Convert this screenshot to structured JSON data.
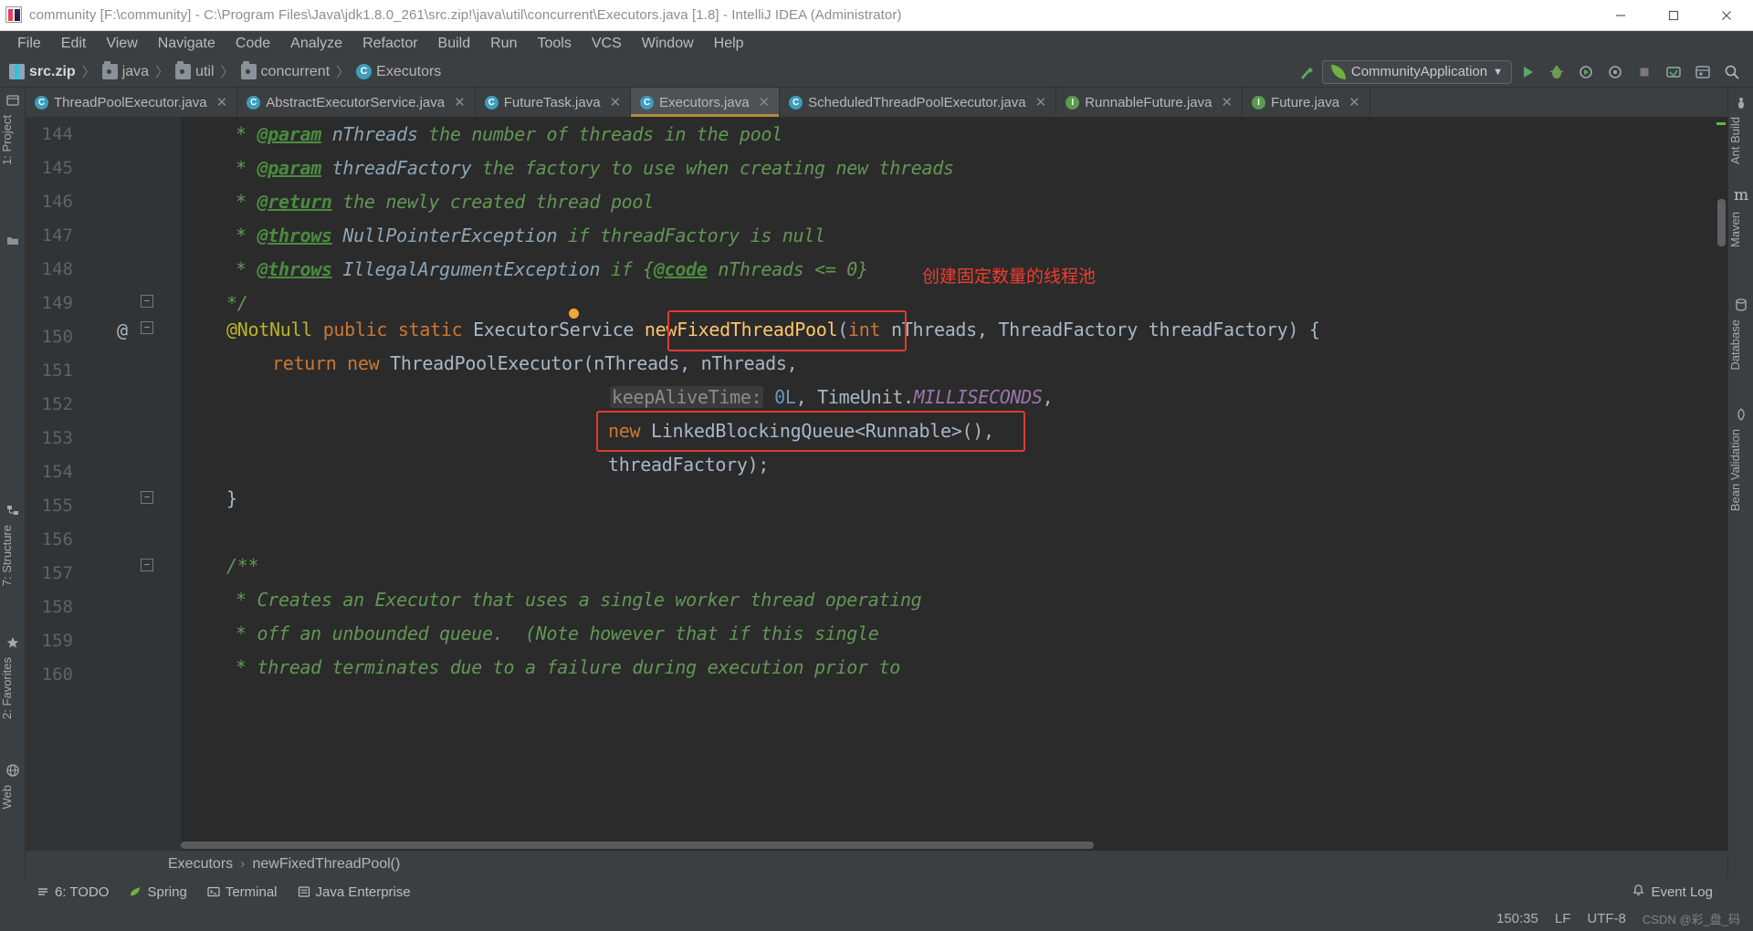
{
  "window": {
    "title": "community [F:\\community] - C:\\Program Files\\Java\\jdk1.8.0_261\\src.zip!\\java\\util\\concurrent\\Executors.java [1.8] - IntelliJ IDEA (Administrator)",
    "app_icon": "intellij-idea-icon",
    "minimize_label": "Minimize",
    "maximize_label": "Maximize",
    "close_label": "Close"
  },
  "menubar": {
    "items": [
      {
        "label": "File",
        "mnemonic": "F"
      },
      {
        "label": "Edit",
        "mnemonic": "E"
      },
      {
        "label": "View",
        "mnemonic": "V"
      },
      {
        "label": "Navigate",
        "mnemonic": "N"
      },
      {
        "label": "Code",
        "mnemonic": "C"
      },
      {
        "label": "Analyze",
        "mnemonic": "z"
      },
      {
        "label": "Refactor",
        "mnemonic": "R"
      },
      {
        "label": "Build",
        "mnemonic": "B"
      },
      {
        "label": "Run",
        "mnemonic": "u"
      },
      {
        "label": "Tools",
        "mnemonic": "T"
      },
      {
        "label": "VCS",
        "mnemonic": "S"
      },
      {
        "label": "Window",
        "mnemonic": "W"
      },
      {
        "label": "Help",
        "mnemonic": "H"
      }
    ]
  },
  "navbar": {
    "breadcrumbs": [
      {
        "label": "src.zip",
        "icon": "zip-icon",
        "active": true
      },
      {
        "label": "java",
        "icon": "folder-icon",
        "active": false
      },
      {
        "label": "util",
        "icon": "folder-icon",
        "active": false
      },
      {
        "label": "concurrent",
        "icon": "folder-icon",
        "active": false
      },
      {
        "label": "Executors",
        "icon": "class-icon",
        "active": false
      }
    ],
    "separator": "〉",
    "run_configuration": "CommunityApplication",
    "run_config_icon": "spring-boot-icon",
    "dropdown_icon": "chevron-down-icon",
    "toolbar_buttons": [
      {
        "name": "run-button",
        "icon": "play-icon",
        "color": "#59a869"
      },
      {
        "name": "debug-button",
        "icon": "bug-icon",
        "color": "#9aa7b0"
      },
      {
        "name": "run-with-coverage-button",
        "icon": "coverage-icon",
        "color": "#9aa7b0"
      },
      {
        "name": "profiler-button",
        "icon": "profiler-icon",
        "color": "#9aa7b0"
      },
      {
        "name": "stop-button",
        "icon": "stop-icon",
        "color": "#7a7a7a"
      },
      {
        "name": "update-project-button",
        "icon": "update-icon",
        "color": "#9aa7b0"
      },
      {
        "name": "settings-button",
        "icon": "gear-icon",
        "color": "#9aa7b0"
      },
      {
        "name": "search-everywhere-button",
        "icon": "search-icon",
        "color": "#9aa7b0"
      }
    ],
    "make_project_icon": "hammer-icon"
  },
  "editor_tabs": [
    {
      "label": "ThreadPoolExecutor.java",
      "icon": "class-icon",
      "selected": false,
      "close_icon": "close-icon"
    },
    {
      "label": "AbstractExecutorService.java",
      "icon": "class-icon",
      "selected": false,
      "close_icon": "close-icon"
    },
    {
      "label": "FutureTask.java",
      "icon": "class-icon",
      "selected": false,
      "close_icon": "close-icon"
    },
    {
      "label": "Executors.java",
      "icon": "class-icon",
      "selected": true,
      "close_icon": "close-icon"
    },
    {
      "label": "ScheduledThreadPoolExecutor.java",
      "icon": "class-icon",
      "selected": false,
      "close_icon": "close-icon"
    },
    {
      "label": "RunnableFuture.java",
      "icon": "interface-icon",
      "selected": false,
      "close_icon": "close-icon"
    },
    {
      "label": "Future.java",
      "icon": "interface-icon",
      "selected": false,
      "close_icon": "close-icon"
    }
  ],
  "left_tool_window_bars": [
    {
      "label": "1: Project",
      "icon": "project-icon"
    },
    {
      "label": "7: Structure",
      "icon": "structure-icon"
    },
    {
      "label": "2: Favorites",
      "icon": "favorites-icon"
    },
    {
      "label": "Web",
      "icon": "web-icon"
    }
  ],
  "right_tool_window_bars": [
    {
      "label": "Ant Build",
      "icon": "ant-icon"
    },
    {
      "label": "Maven",
      "icon": "maven-icon"
    },
    {
      "label": "Database",
      "icon": "database-icon"
    },
    {
      "label": "Bean Validation",
      "icon": "bean-icon"
    }
  ],
  "code": {
    "lines": [
      {
        "num": "144",
        "text": " * @param nThreads the number of threads in the pool"
      },
      {
        "num": "145",
        "text": " * @param threadFactory the factory to use when creating new threads"
      },
      {
        "num": "146",
        "text": " * @return the newly created thread pool"
      },
      {
        "num": "147",
        "text": " * @throws NullPointerException if threadFactory is null"
      },
      {
        "num": "148",
        "text": " * @throws IllegalArgumentException if {@code nThreads <= 0}"
      },
      {
        "num": "149",
        "text": " */"
      },
      {
        "num": "150",
        "text": "@NotNull public static ExecutorService newFixedThreadPool(int nThreads, ThreadFactory threadFactory) {"
      },
      {
        "num": "151",
        "text": "    return new ThreadPoolExecutor(nThreads, nThreads,"
      },
      {
        "num": "152",
        "text": "                 keepAliveTime: 0L, TimeUnit.MILLISECONDS,"
      },
      {
        "num": "153",
        "text": "                 new LinkedBlockingQueue<Runnable>(),"
      },
      {
        "num": "154",
        "text": "                 threadFactory);"
      },
      {
        "num": "155",
        "text": "}"
      },
      {
        "num": "156",
        "text": ""
      },
      {
        "num": "157",
        "text": "/**"
      },
      {
        "num": "158",
        "text": " * Creates an Executor that uses a single worker thread operating"
      },
      {
        "num": "159",
        "text": " * off an unbounded queue.  (Note however that if this single"
      },
      {
        "num": "160",
        "text": " * thread terminates due to a failure during execution prior to"
      }
    ],
    "tokens": {
      "param_tag": "@param",
      "return_tag": "@return",
      "throws_tag": "@throws",
      "code_tag": "@code",
      "not_null_annotation": "@NotNull",
      "kw_public": "public",
      "kw_static": "static",
      "kw_return": "return",
      "kw_new": "new",
      "kw_int": "int",
      "type_executor_service": "ExecutorService",
      "method_name": "newFixedThreadPool",
      "arg_n_threads": "nThreads",
      "type_thread_factory": "ThreadFactory",
      "arg_thread_factory": "threadFactory",
      "type_thread_pool_executor": "ThreadPoolExecutor",
      "hint_keep_alive": "keepAliveTime:",
      "literal_zero_l": "0L",
      "type_time_unit": "TimeUnit",
      "const_milliseconds": "MILLISECONDS",
      "type_linked_blocking_queue": "LinkedBlockingQueue<Runnable>()",
      "gutter_annotation_marker": "@"
    }
  },
  "annotations": {
    "chinese_note": "创建固定数量的线程池",
    "note_color": "#f03c2e",
    "box_color": "#e03b2f",
    "boxes": [
      {
        "name": "method-name-highlight-box",
        "target": "newFixedThreadPool"
      },
      {
        "name": "queue-highlight-box",
        "target": "new LinkedBlockingQueue<Runnable>(),"
      }
    ]
  },
  "editor_breadcrumb": {
    "items": [
      "Executors",
      "newFixedThreadPool()"
    ],
    "separator": "›"
  },
  "bottom_toolbar": [
    {
      "label": "6: TODO",
      "icon": "todo-icon"
    },
    {
      "label": "Spring",
      "icon": "spring-icon"
    },
    {
      "label": "Terminal",
      "icon": "terminal-icon"
    },
    {
      "label": "Java Enterprise",
      "icon": "java-enterprise-icon"
    }
  ],
  "statusbar": {
    "caret_position": "150:35",
    "line_separator": "LF",
    "encoding": "UTF-8",
    "event_log": "Event Log",
    "event_log_icon": "bell-icon",
    "watermark": "CSDN @彩_盘_码"
  }
}
